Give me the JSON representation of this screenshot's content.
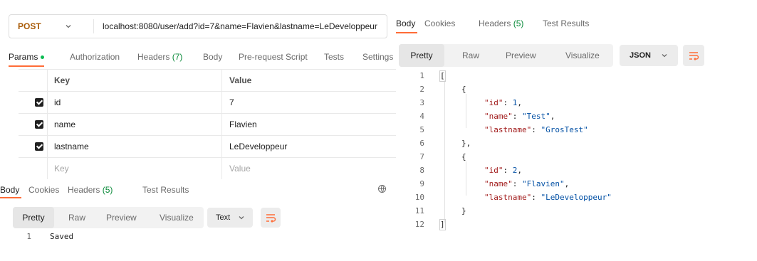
{
  "request": {
    "method": "POST",
    "url": "localhost:8080/user/add?id=7&name=Flavien&lastname=LeDeveloppeur"
  },
  "request_tabs": {
    "params": "Params",
    "authorization": "Authorization",
    "headers": "Headers",
    "headers_count": "(7)",
    "body": "Body",
    "pre_request": "Pre-request Script",
    "tests": "Tests",
    "settings": "Settings"
  },
  "params_table": {
    "col_key": "Key",
    "col_value": "Value",
    "rows": [
      {
        "key": "id",
        "value": "7",
        "checked": true
      },
      {
        "key": "name",
        "value": "Flavien",
        "checked": true
      },
      {
        "key": "lastname",
        "value": "LeDeveloppeur",
        "checked": true
      }
    ],
    "placeholder_key": "Key",
    "placeholder_value": "Value"
  },
  "response_left": {
    "tabs": {
      "body": "Body",
      "cookies": "Cookies",
      "headers": "Headers",
      "headers_count": "(5)",
      "test_results": "Test Results"
    },
    "formats": {
      "pretty": "Pretty",
      "raw": "Raw",
      "preview": "Preview",
      "visualize": "Visualize"
    },
    "language": "Text",
    "code": [
      {
        "n": "1",
        "text": "Saved"
      }
    ]
  },
  "response_right": {
    "tabs": {
      "body": "Body",
      "cookies": "Cookies",
      "headers": "Headers",
      "headers_count": "(5)",
      "test_results": "Test Results"
    },
    "formats": {
      "pretty": "Pretty",
      "raw": "Raw",
      "preview": "Preview",
      "visualize": "Visualize"
    },
    "language": "JSON",
    "line_numbers": [
      "1",
      "2",
      "3",
      "4",
      "5",
      "6",
      "7",
      "8",
      "9",
      "10",
      "11",
      "12"
    ],
    "json": {
      "open": "[",
      "close": "]",
      "obj_open": "{",
      "obj_close_comma": "},",
      "obj_close": "}",
      "items": [
        {
          "id_key": "\"id\"",
          "id_val": "1",
          "name_key": "\"name\"",
          "name_val": "\"Test\"",
          "lastname_key": "\"lastname\"",
          "lastname_val": "\"GrosTest\""
        },
        {
          "id_key": "\"id\"",
          "id_val": "2",
          "name_key": "\"name\"",
          "name_val": "\"Flavien\"",
          "lastname_key": "\"lastname\"",
          "lastname_val": "\"LeDeveloppeur\""
        }
      ]
    }
  },
  "colors": {
    "accent": "#ff6c37",
    "method": "#a95b08",
    "count": "#0a8a3a",
    "json_key": "#a11a1a",
    "json_value": "#0451a5"
  },
  "icons": [
    "chevron-down-icon",
    "checkbox-checked-icon",
    "globe-icon",
    "wrap-lines-icon"
  ]
}
